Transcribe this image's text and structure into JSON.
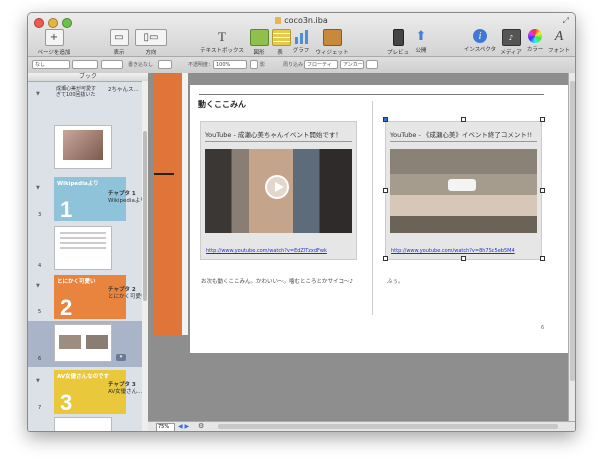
{
  "window": {
    "title": "coco3n.iba"
  },
  "toolbar": {
    "items": [
      {
        "label": "ページを追加",
        "icon": "add-page-icon"
      },
      {
        "label": "表示",
        "icon": "view-icon"
      },
      {
        "label": "方向",
        "icon": "orientation-icon"
      },
      {
        "label": "テキストボックス",
        "icon": "textbox-icon"
      },
      {
        "label": "図形",
        "icon": "shapes-icon"
      },
      {
        "label": "表",
        "icon": "table-icon"
      },
      {
        "label": "グラフ",
        "icon": "chart-icon"
      },
      {
        "label": "ウィジェット",
        "icon": "widget-icon"
      },
      {
        "label": "プレビュー",
        "icon": "preview-icon"
      },
      {
        "label": "公開",
        "icon": "publish-icon"
      },
      {
        "label": "インスペクタ",
        "icon": "inspector-icon"
      },
      {
        "label": "メディア",
        "icon": "media-icon"
      },
      {
        "label": "カラー",
        "icon": "colors-icon"
      },
      {
        "label": "フォント",
        "icon": "fonts-icon"
      }
    ],
    "add_glyph": "+",
    "textbox_glyph": "T",
    "inspector_glyph": "i",
    "fonts_glyph": "A"
  },
  "format_bar": {
    "style": "なし",
    "spacing_label": "書き込なし",
    "opacity_label": "不透明度：",
    "opacity_value": "100%",
    "shadow_label": "影",
    "wrap_label": "周り込み",
    "float_value": "フローティ",
    "anchor_value": "アンカー"
  },
  "sidebar": {
    "header": "ブック",
    "items": [
      {
        "index": "",
        "thumb_text": "成瀬心美が可愛すぎて100回抜いた",
        "label": "2ちゃんス..."
      },
      {
        "index": "",
        "thumb_text": "",
        "label": ""
      },
      {
        "index": "3",
        "chapter_title": "Wikipediaより",
        "num": "1",
        "chapter": "チャプタ 1",
        "chapter_sub": "Wikipediaより"
      },
      {
        "index": "4",
        "label": ""
      },
      {
        "index": "5",
        "chapter_title": "とにかく可愛い",
        "num": "2",
        "chapter": "チャプタ 2",
        "chapter_sub": "とにかく可愛い"
      },
      {
        "index": "6",
        "label": ""
      },
      {
        "index": "7",
        "chapter_title": "AV女優さんなのです",
        "num": "3",
        "chapter": "チャプタ 3",
        "chapter_sub": "AV女優さん..."
      }
    ]
  },
  "page": {
    "heading": "動くここみん",
    "videos": [
      {
        "title": "YouTube - 成瀬心美ちゃんイベント開始です！",
        "url": "http://www.youtube.com/watch?v=EdZlTzxdFwk",
        "caption": "お次も動くここみん。かわいい〜。噛むところとかサイコ〜♪"
      },
      {
        "title": "YouTube - 《成瀬心美》イベント終了コメント!!",
        "url": "http://www.youtube.com/watch?v=8h7Sc5eb5M4",
        "caption": "ふぅ。"
      }
    ],
    "page_number": "6"
  },
  "status": {
    "zoom": "75%"
  },
  "colors": {
    "chapter1": "#8fc3d9",
    "chapter2": "#e9843f",
    "chapter3": "#e9c93b",
    "link": "#2233cc",
    "selection": "#a9b4c8"
  }
}
